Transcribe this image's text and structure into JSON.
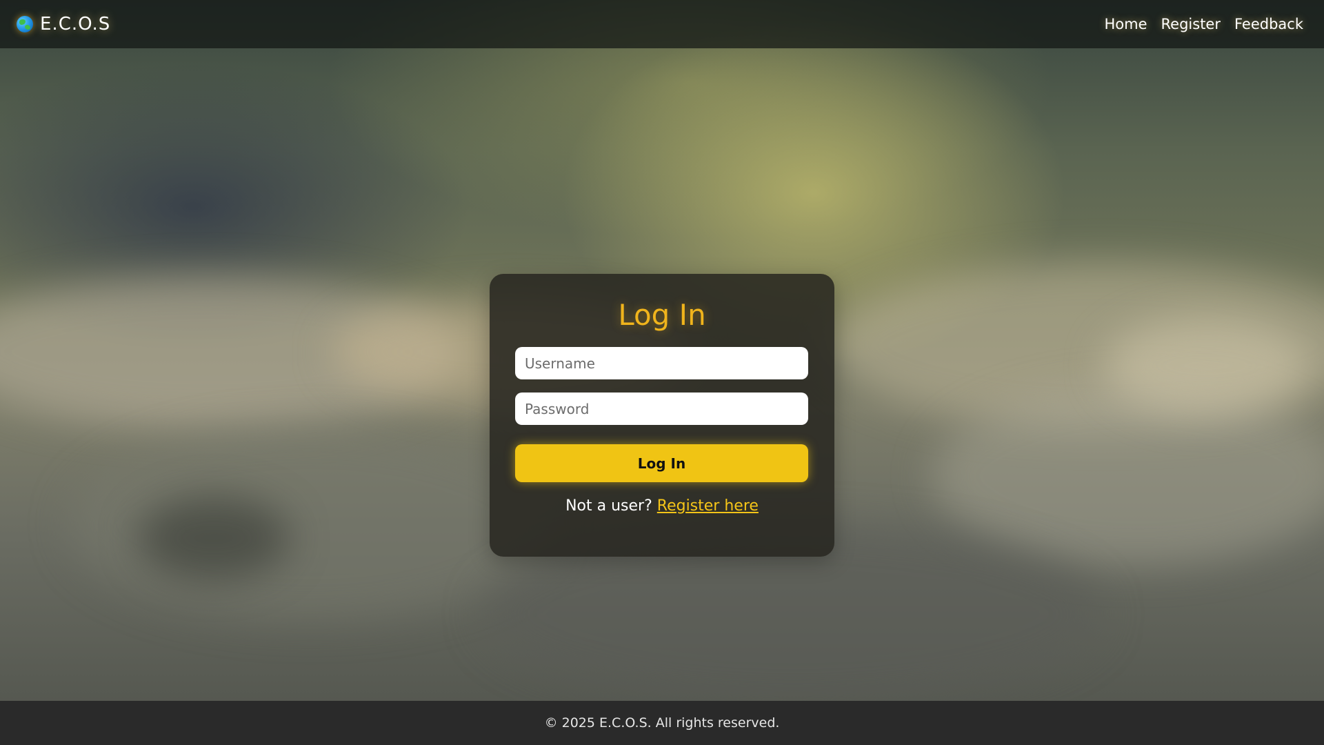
{
  "header": {
    "brand_name": "E.C.O.S",
    "brand_icon": "globe-icon",
    "nav": [
      {
        "label": "Home"
      },
      {
        "label": "Register"
      },
      {
        "label": "Feedback"
      }
    ]
  },
  "login_form": {
    "title": "Log In",
    "username": {
      "placeholder": "Username",
      "value": ""
    },
    "password": {
      "placeholder": "Password",
      "value": ""
    },
    "submit_label": "Log In",
    "register_prompt": "Not a user?",
    "register_link": "Register here"
  },
  "footer": {
    "text": "© 2025 E.C.O.S. All rights reserved."
  },
  "colors": {
    "accent": "#f0c414",
    "title": "#f0b41c",
    "link": "#f5c518",
    "card_bg": "#26241e",
    "footer_bg": "#2a2a2a"
  }
}
